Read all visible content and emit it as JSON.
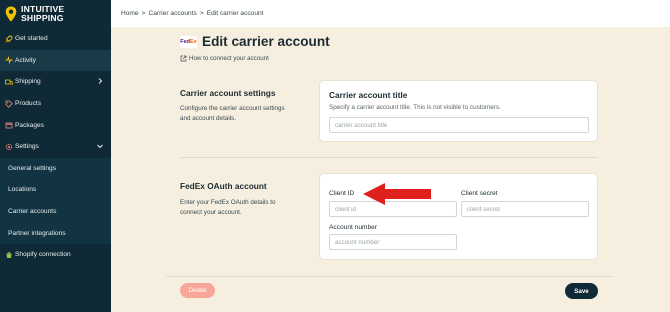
{
  "brand": {
    "line1": "INTUITIVE",
    "line2": "SHIPPING",
    "accent": "#f5c400"
  },
  "sidebar": {
    "items": [
      {
        "label": "Get started",
        "icon": "rocket-icon"
      },
      {
        "label": "Activity",
        "icon": "activity-icon"
      },
      {
        "label": "Shipping",
        "icon": "truck-icon"
      },
      {
        "label": "Products",
        "icon": "tag-icon"
      },
      {
        "label": "Packages",
        "icon": "box-icon"
      },
      {
        "label": "Settings",
        "icon": "gear-icon"
      }
    ],
    "settings_sub": [
      "General settings",
      "Locations",
      "Carrier accounts",
      "Partner integrations"
    ],
    "shopify": {
      "label": "Shopify connection",
      "icon": "shopify-icon"
    }
  },
  "breadcrumb": {
    "home": "Home",
    "carriers": "Carrier accounts",
    "current": "Edit carrier account",
    "sep": ">"
  },
  "page": {
    "logo": {
      "fe": "Fed",
      "ex": "Ex"
    },
    "title": "Edit carrier account",
    "help_link": "How to connect your account"
  },
  "settings_section": {
    "label": "Carrier account settings",
    "desc": "Configure the carrier account settings and account details.",
    "card_title": "Carrier account title",
    "card_desc": "Specify a carrier account title. This is not visible to customers.",
    "title_placeholder": "carrier account title"
  },
  "oauth_section": {
    "label": "FedEx OAuth account",
    "desc": "Enter your FedEx OAuth details to connect your account.",
    "client_id_label": "Client ID",
    "client_id_placeholder": "client id",
    "client_secret_label": "Client secret",
    "client_secret_placeholder": "client secret",
    "account_number_label": "Account number",
    "account_number_placeholder": "account number"
  },
  "actions": {
    "delete": "Delete",
    "save": "Save"
  },
  "colors": {
    "sidebar_bg": "#0f2a36",
    "page_bg": "#f6efe0",
    "annotation_arrow": "#e0201d",
    "delete_btn": "#f6a79a"
  }
}
